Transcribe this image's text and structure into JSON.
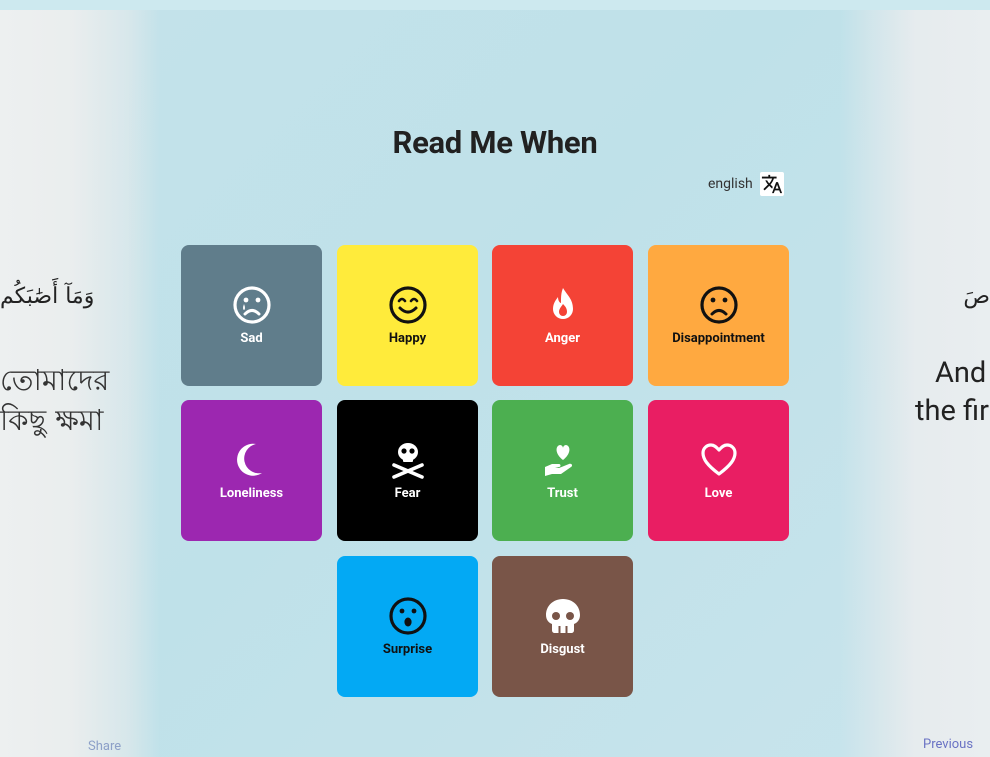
{
  "title": "Read Me When",
  "language": {
    "label": "english",
    "icon": "translate-icon"
  },
  "background": {
    "left_arabic": "وَمَآ أَصَٰبَكُم",
    "left_bengali_line1": "তোমাদের",
    "left_bengali_line2": "কিছু ক্ষমা",
    "right_arabic": "صَ",
    "right_english_line1": "And",
    "right_english_line2": "the fir",
    "share_label": "Share",
    "previous_label": "Previous"
  },
  "emotions": [
    {
      "label": "Sad",
      "icon": "crying-face-icon",
      "color": "#607D8B"
    },
    {
      "label": "Happy",
      "icon": "smiling-face-icon",
      "color": "#FFEB3B"
    },
    {
      "label": "Anger",
      "icon": "fire-icon",
      "color": "#F44336"
    },
    {
      "label": "Disappointment",
      "icon": "frowning-face-icon",
      "color": "#FFA940"
    },
    {
      "label": "Loneliness",
      "icon": "moon-icon",
      "color": "#9C27B0"
    },
    {
      "label": "Fear",
      "icon": "skull-crossbones-icon",
      "color": "#000000"
    },
    {
      "label": "Trust",
      "icon": "hand-holding-heart-icon",
      "color": "#4CAF50"
    },
    {
      "label": "Love",
      "icon": "heart-outline-icon",
      "color": "#E91E63"
    },
    {
      "label": "Surprise",
      "icon": "surprised-face-icon",
      "color": "#03A9F4"
    },
    {
      "label": "Disgust",
      "icon": "skull-icon",
      "color": "#795548"
    }
  ]
}
